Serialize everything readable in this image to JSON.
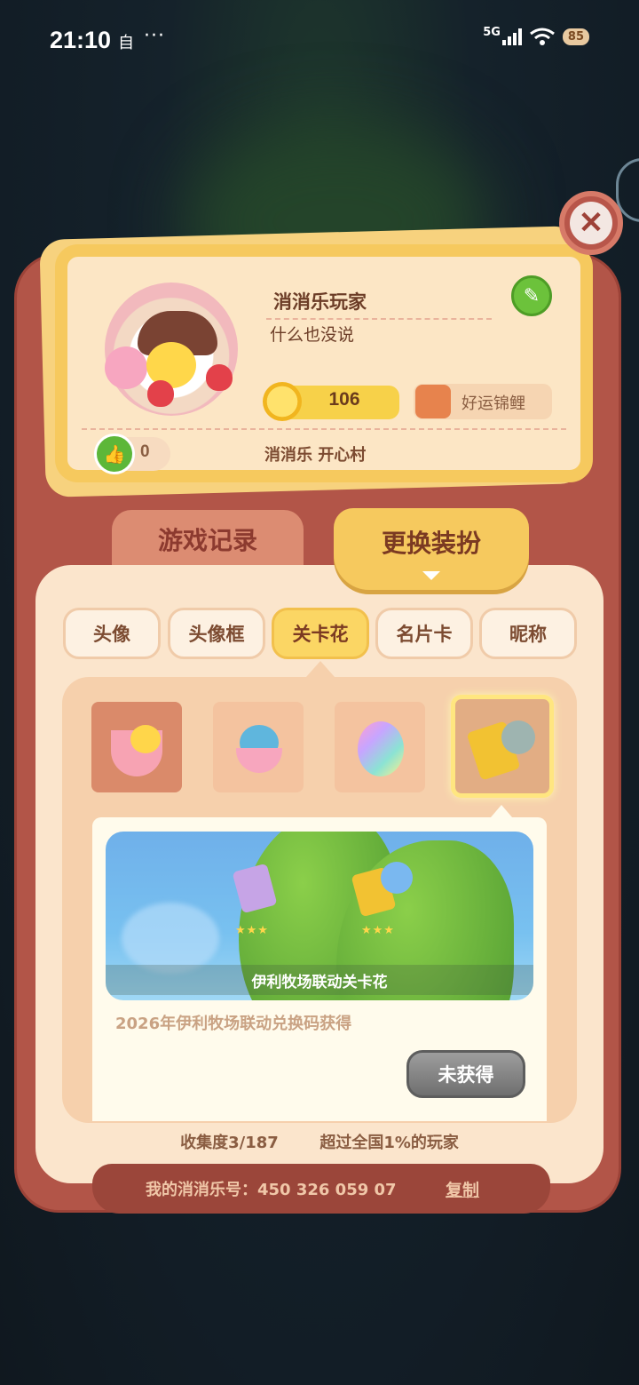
{
  "status_bar": {
    "time": "21:10",
    "notif_icon": "自",
    "more_dots": "···",
    "network": "5G",
    "battery": "85"
  },
  "profile": {
    "player_name": "消消乐玩家",
    "signature": "什么也没说",
    "coins": "106",
    "title": "好运锦鲤",
    "likes": "0",
    "village": "消消乐   开心村"
  },
  "tabs": {
    "records": "游戏记录",
    "outfit": "更换装扮"
  },
  "sub_tabs": [
    "头像",
    "头像框",
    "关卡花",
    "名片卡",
    "昵称"
  ],
  "active_sub_tab": "关卡花",
  "items": [
    "ice-cream-chick",
    "blue-dino-egg",
    "rainbow-flower",
    "yili-snack-bag"
  ],
  "detail": {
    "preview_caption": "伊利牧场联动关卡花",
    "stars_left": "★★★",
    "stars_right": "★★★",
    "description": "2026年伊利牧场联动兑换码获得",
    "status_button": "未获得"
  },
  "collection": {
    "text": "收集度3/187",
    "rank": "超过全国1%的玩家"
  },
  "footer": {
    "account": "我的消消乐号：450 326 059 07",
    "copy": "复制"
  },
  "colors": {
    "wallet": "#b25548",
    "panel": "#fbe5cc",
    "accent_yellow": "#f6c95e",
    "green": "#6cc23b"
  }
}
